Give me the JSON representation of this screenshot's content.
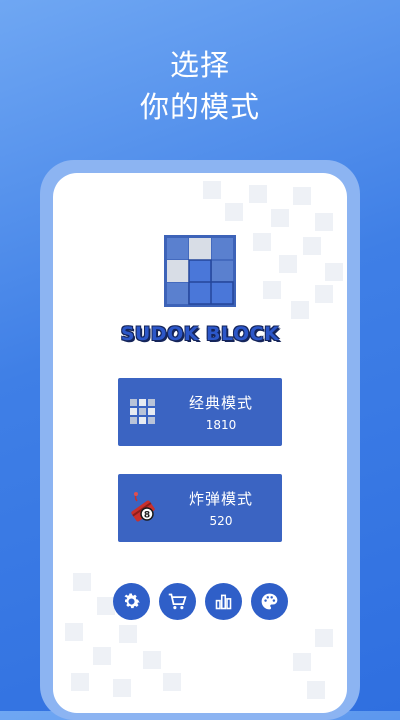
{
  "headline": {
    "line1": "选择",
    "line2": "你的模式"
  },
  "app": {
    "logo_title": "SUDOK BLOCK"
  },
  "modes": [
    {
      "label": "经典模式",
      "score": "1810",
      "icon": "grid-icon"
    },
    {
      "label": "炸弹模式",
      "score": "520",
      "icon": "bomb-icon"
    }
  ],
  "toolbar": [
    {
      "icon": "gear-icon"
    },
    {
      "icon": "cart-icon"
    },
    {
      "icon": "bar-chart-icon"
    },
    {
      "icon": "palette-icon"
    }
  ],
  "colors": {
    "background_top": "#6fa7f3",
    "background_bottom": "#2f6fe0",
    "button": "#3b64c2",
    "circle_button": "#2f5fc8",
    "logo_text": "#2c57c9"
  }
}
